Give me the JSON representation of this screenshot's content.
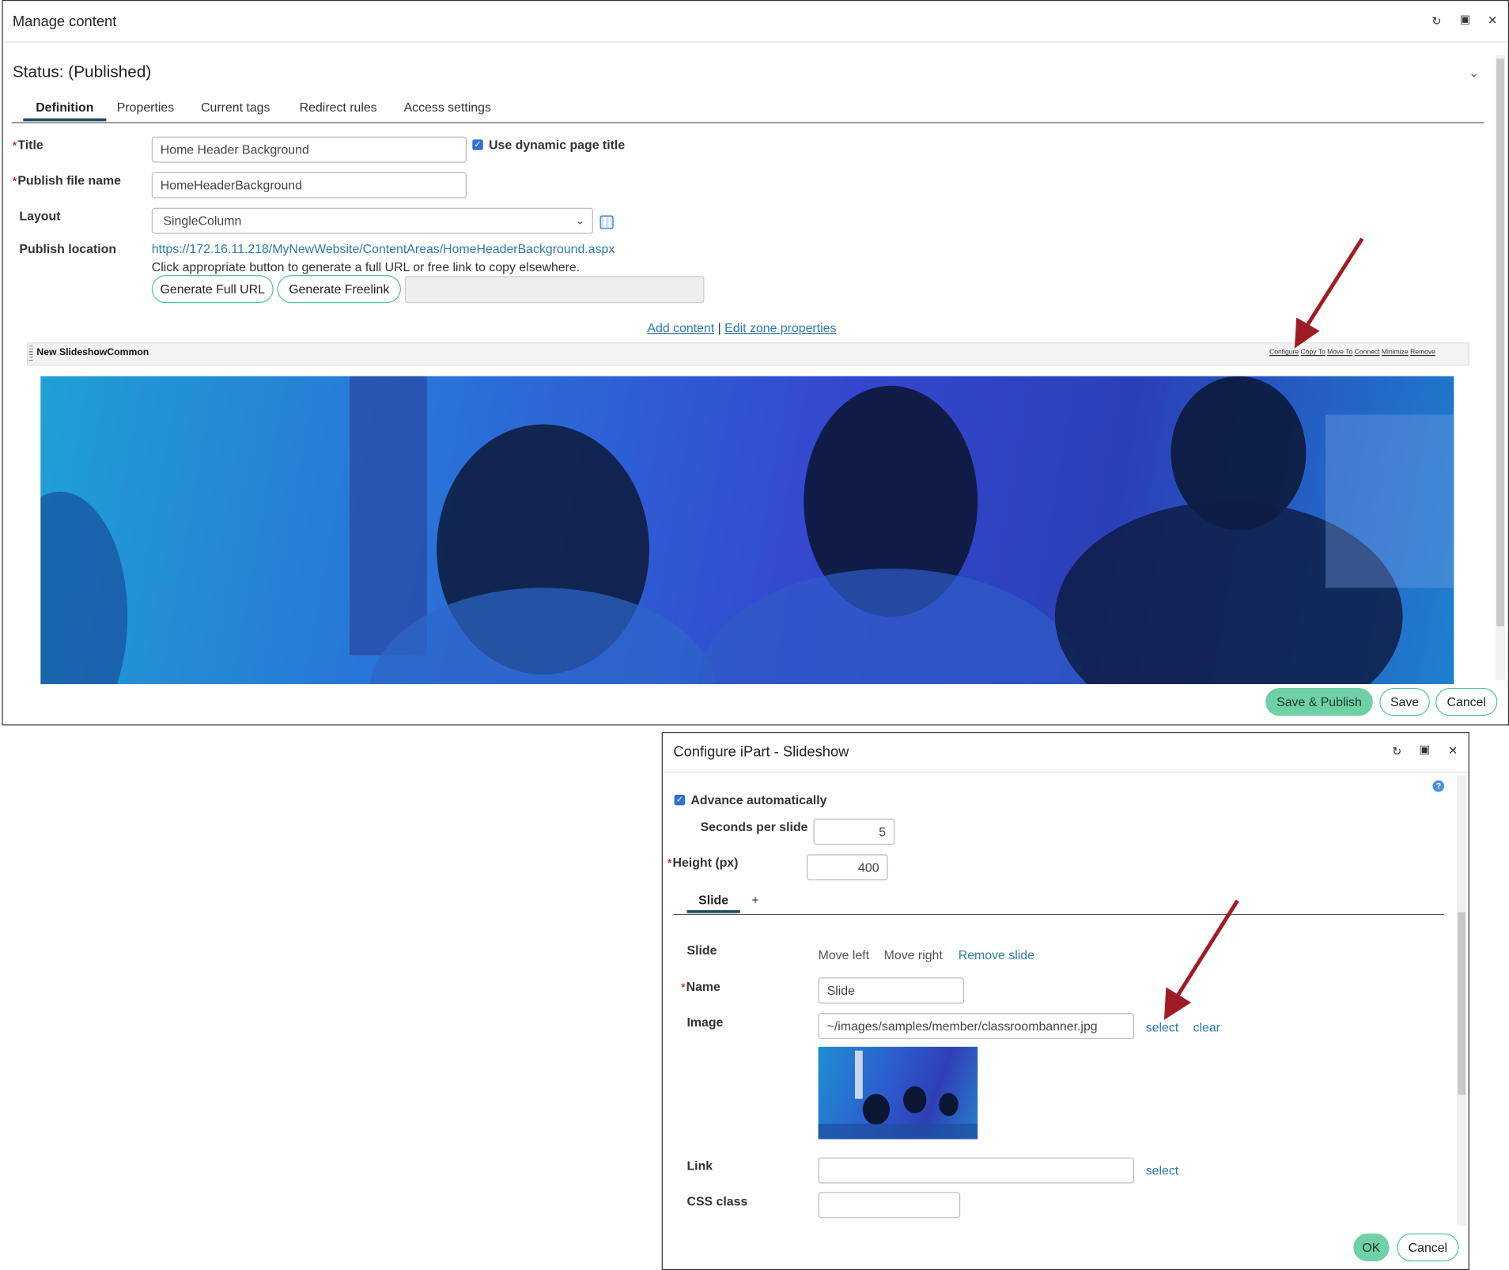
{
  "manage": {
    "title": "Manage content",
    "status": "Status: (Published)",
    "tabs": [
      "Definition",
      "Properties",
      "Current tags",
      "Redirect rules",
      "Access settings"
    ],
    "fields": {
      "title_label": "Title",
      "title_value": "Home Header Background",
      "dynamic_title_label": "Use dynamic page title",
      "publish_file_label": "Publish file name",
      "publish_file_value": "HomeHeaderBackground",
      "layout_label": "Layout",
      "layout_value": "SingleColumn",
      "publish_location_label": "Publish location",
      "publish_url": "https://172.16.11.218/MyNewWebsite/ContentAreas/HomeHeaderBackground.aspx",
      "publish_hint": "Click appropriate button to generate a full URL or free link to copy elsewhere.",
      "generate_full_url": "Generate Full URL",
      "generate_freelink": "Generate Freelink"
    },
    "zone_links": {
      "add_content": "Add content",
      "separator": "|",
      "edit_zone": "Edit zone properties"
    },
    "webpart": {
      "name": "New SlideshowCommon",
      "actions": [
        "Configure",
        "Copy To",
        "Move To",
        "Connect",
        "Minimize",
        "Remove"
      ]
    },
    "buttons": {
      "save_publish": "Save & Publish",
      "save": "Save",
      "cancel": "Cancel"
    }
  },
  "configure": {
    "title": "Configure iPart - Slideshow",
    "advance_label": "Advance automatically",
    "seconds_label": "Seconds per slide",
    "seconds_value": "5",
    "height_label": "Height (px)",
    "height_value": "400",
    "tabs": [
      "Slide",
      "+"
    ],
    "slide_label": "Slide",
    "slide_actions": {
      "move_left": "Move left",
      "move_right": "Move right",
      "remove": "Remove slide"
    },
    "name_label": "Name",
    "name_value": "Slide",
    "image_label": "Image",
    "image_value": "~/images/samples/member/classroombanner.jpg",
    "image_select": "select",
    "image_clear": "clear",
    "link_label": "Link",
    "link_select": "select",
    "css_label": "CSS class",
    "buttons": {
      "ok": "OK",
      "cancel": "Cancel"
    }
  },
  "colors": {
    "accent_green": "#6fd0a6",
    "link_blue": "#2a7ab0",
    "arrow_red": "#a01c24",
    "tab_underline": "#1f4e5f"
  }
}
